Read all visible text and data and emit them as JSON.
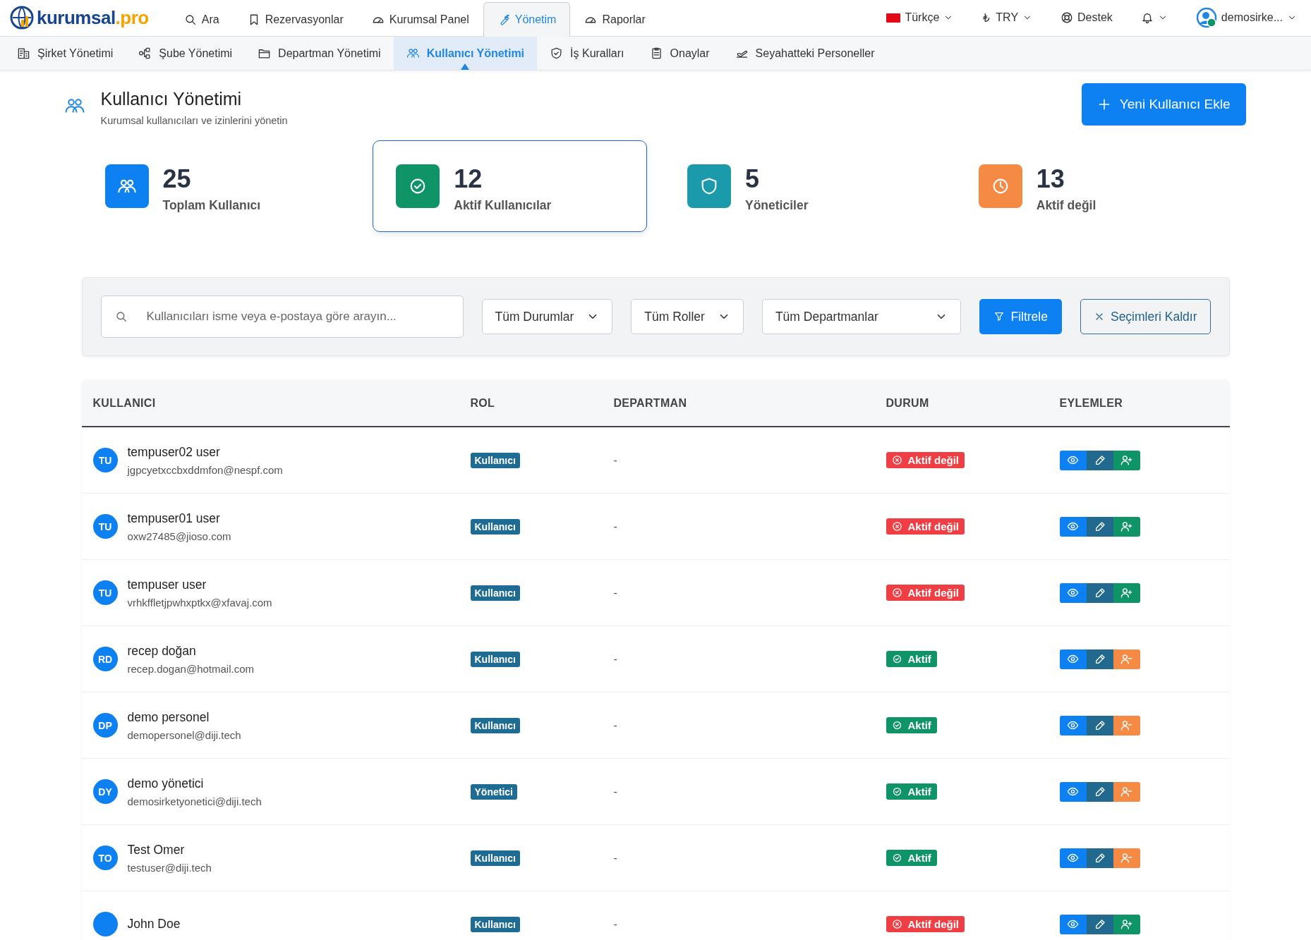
{
  "topbar": {
    "logo": {
      "word": "kurumsal",
      "suffix": ".pro"
    },
    "nav": [
      {
        "label": "Ara",
        "selected": false
      },
      {
        "label": "Rezervasyonlar",
        "selected": false
      },
      {
        "label": "Kurumsal Panel",
        "selected": false
      },
      {
        "label": "Yönetim",
        "selected": true
      },
      {
        "label": "Raporlar",
        "selected": false
      }
    ],
    "language": "Türkçe",
    "currency": "TRY",
    "support": "Destek",
    "user": "demosirke..."
  },
  "subnav": [
    {
      "label": "Şirket Yönetimi",
      "selected": false
    },
    {
      "label": "Şube Yönetimi",
      "selected": false
    },
    {
      "label": "Departman Yönetimi",
      "selected": false
    },
    {
      "label": "Kullanıcı Yönetimi",
      "selected": true
    },
    {
      "label": "İş Kuralları",
      "selected": false
    },
    {
      "label": "Onaylar",
      "selected": false
    },
    {
      "label": "Seyahatteki Personeller",
      "selected": false
    }
  ],
  "header": {
    "title": "Kullanıcı Yönetimi",
    "subtitle": "Kurumsal kullanıcıları ve izinlerini yönetin",
    "add_button": "Yeni Kullanıcı Ekle"
  },
  "stats": [
    {
      "value": "25",
      "label": "Toplam Kullanıcı",
      "color": "#0d80f2",
      "selected": false
    },
    {
      "value": "12",
      "label": "Aktif Kullanıcılar",
      "color": "#0e9466",
      "selected": true
    },
    {
      "value": "5",
      "label": "Yöneticiler",
      "color": "#1a9aaa",
      "selected": false
    },
    {
      "value": "13",
      "label": "Aktif değil",
      "color": "#f58a45",
      "selected": false
    }
  ],
  "filters": {
    "search": {
      "placeholder": "Kullanıcıları isme veya e-postaya göre arayın..."
    },
    "dropdowns": [
      "Tüm Durumlar",
      "Tüm Roller",
      "Tüm Departmanlar"
    ],
    "apply": "Filtrele",
    "clear": "Seçimleri Kaldır"
  },
  "table": {
    "columns": [
      "KULLANICI",
      "ROL",
      "DEPARTMAN",
      "DURUM",
      "EYLEMLER"
    ],
    "rows": [
      {
        "initials": "TU",
        "name": "tempuser02 user",
        "email": "jgpcyetxccbxddmfon@nespf.com",
        "role": "Kullanıcı",
        "department": "-",
        "status": "Aktif değil",
        "active": false
      },
      {
        "initials": "TU",
        "name": "tempuser01 user",
        "email": "oxw27485@jioso.com",
        "role": "Kullanıcı",
        "department": "-",
        "status": "Aktif değil",
        "active": false
      },
      {
        "initials": "TU",
        "name": "tempuser user",
        "email": "vrhkffletjpwhxptkx@xfavaj.com",
        "role": "Kullanıcı",
        "department": "-",
        "status": "Aktif değil",
        "active": false
      },
      {
        "initials": "RD",
        "name": "recep doğan",
        "email": "recep.dogan@hotmail.com",
        "role": "Kullanıcı",
        "department": "-",
        "status": "Aktif",
        "active": true
      },
      {
        "initials": "DP",
        "name": "demo personel",
        "email": "demopersonel@diji.tech",
        "role": "Kullanıcı",
        "department": "-",
        "status": "Aktif",
        "active": true
      },
      {
        "initials": "DY",
        "name": "demo yönetici",
        "email": "demosirketyonetici@diji.tech",
        "role": "Yönetici",
        "department": "-",
        "status": "Aktif",
        "active": true
      },
      {
        "initials": "TO",
        "name": "Test Omer",
        "email": "testuser@diji.tech",
        "role": "Kullanıcı",
        "department": "-",
        "status": "Aktif",
        "active": true
      },
      {
        "name": "John Doe",
        "role": "Kullanıcı",
        "department": "-",
        "status": "Aktif değil",
        "active": false
      }
    ]
  }
}
